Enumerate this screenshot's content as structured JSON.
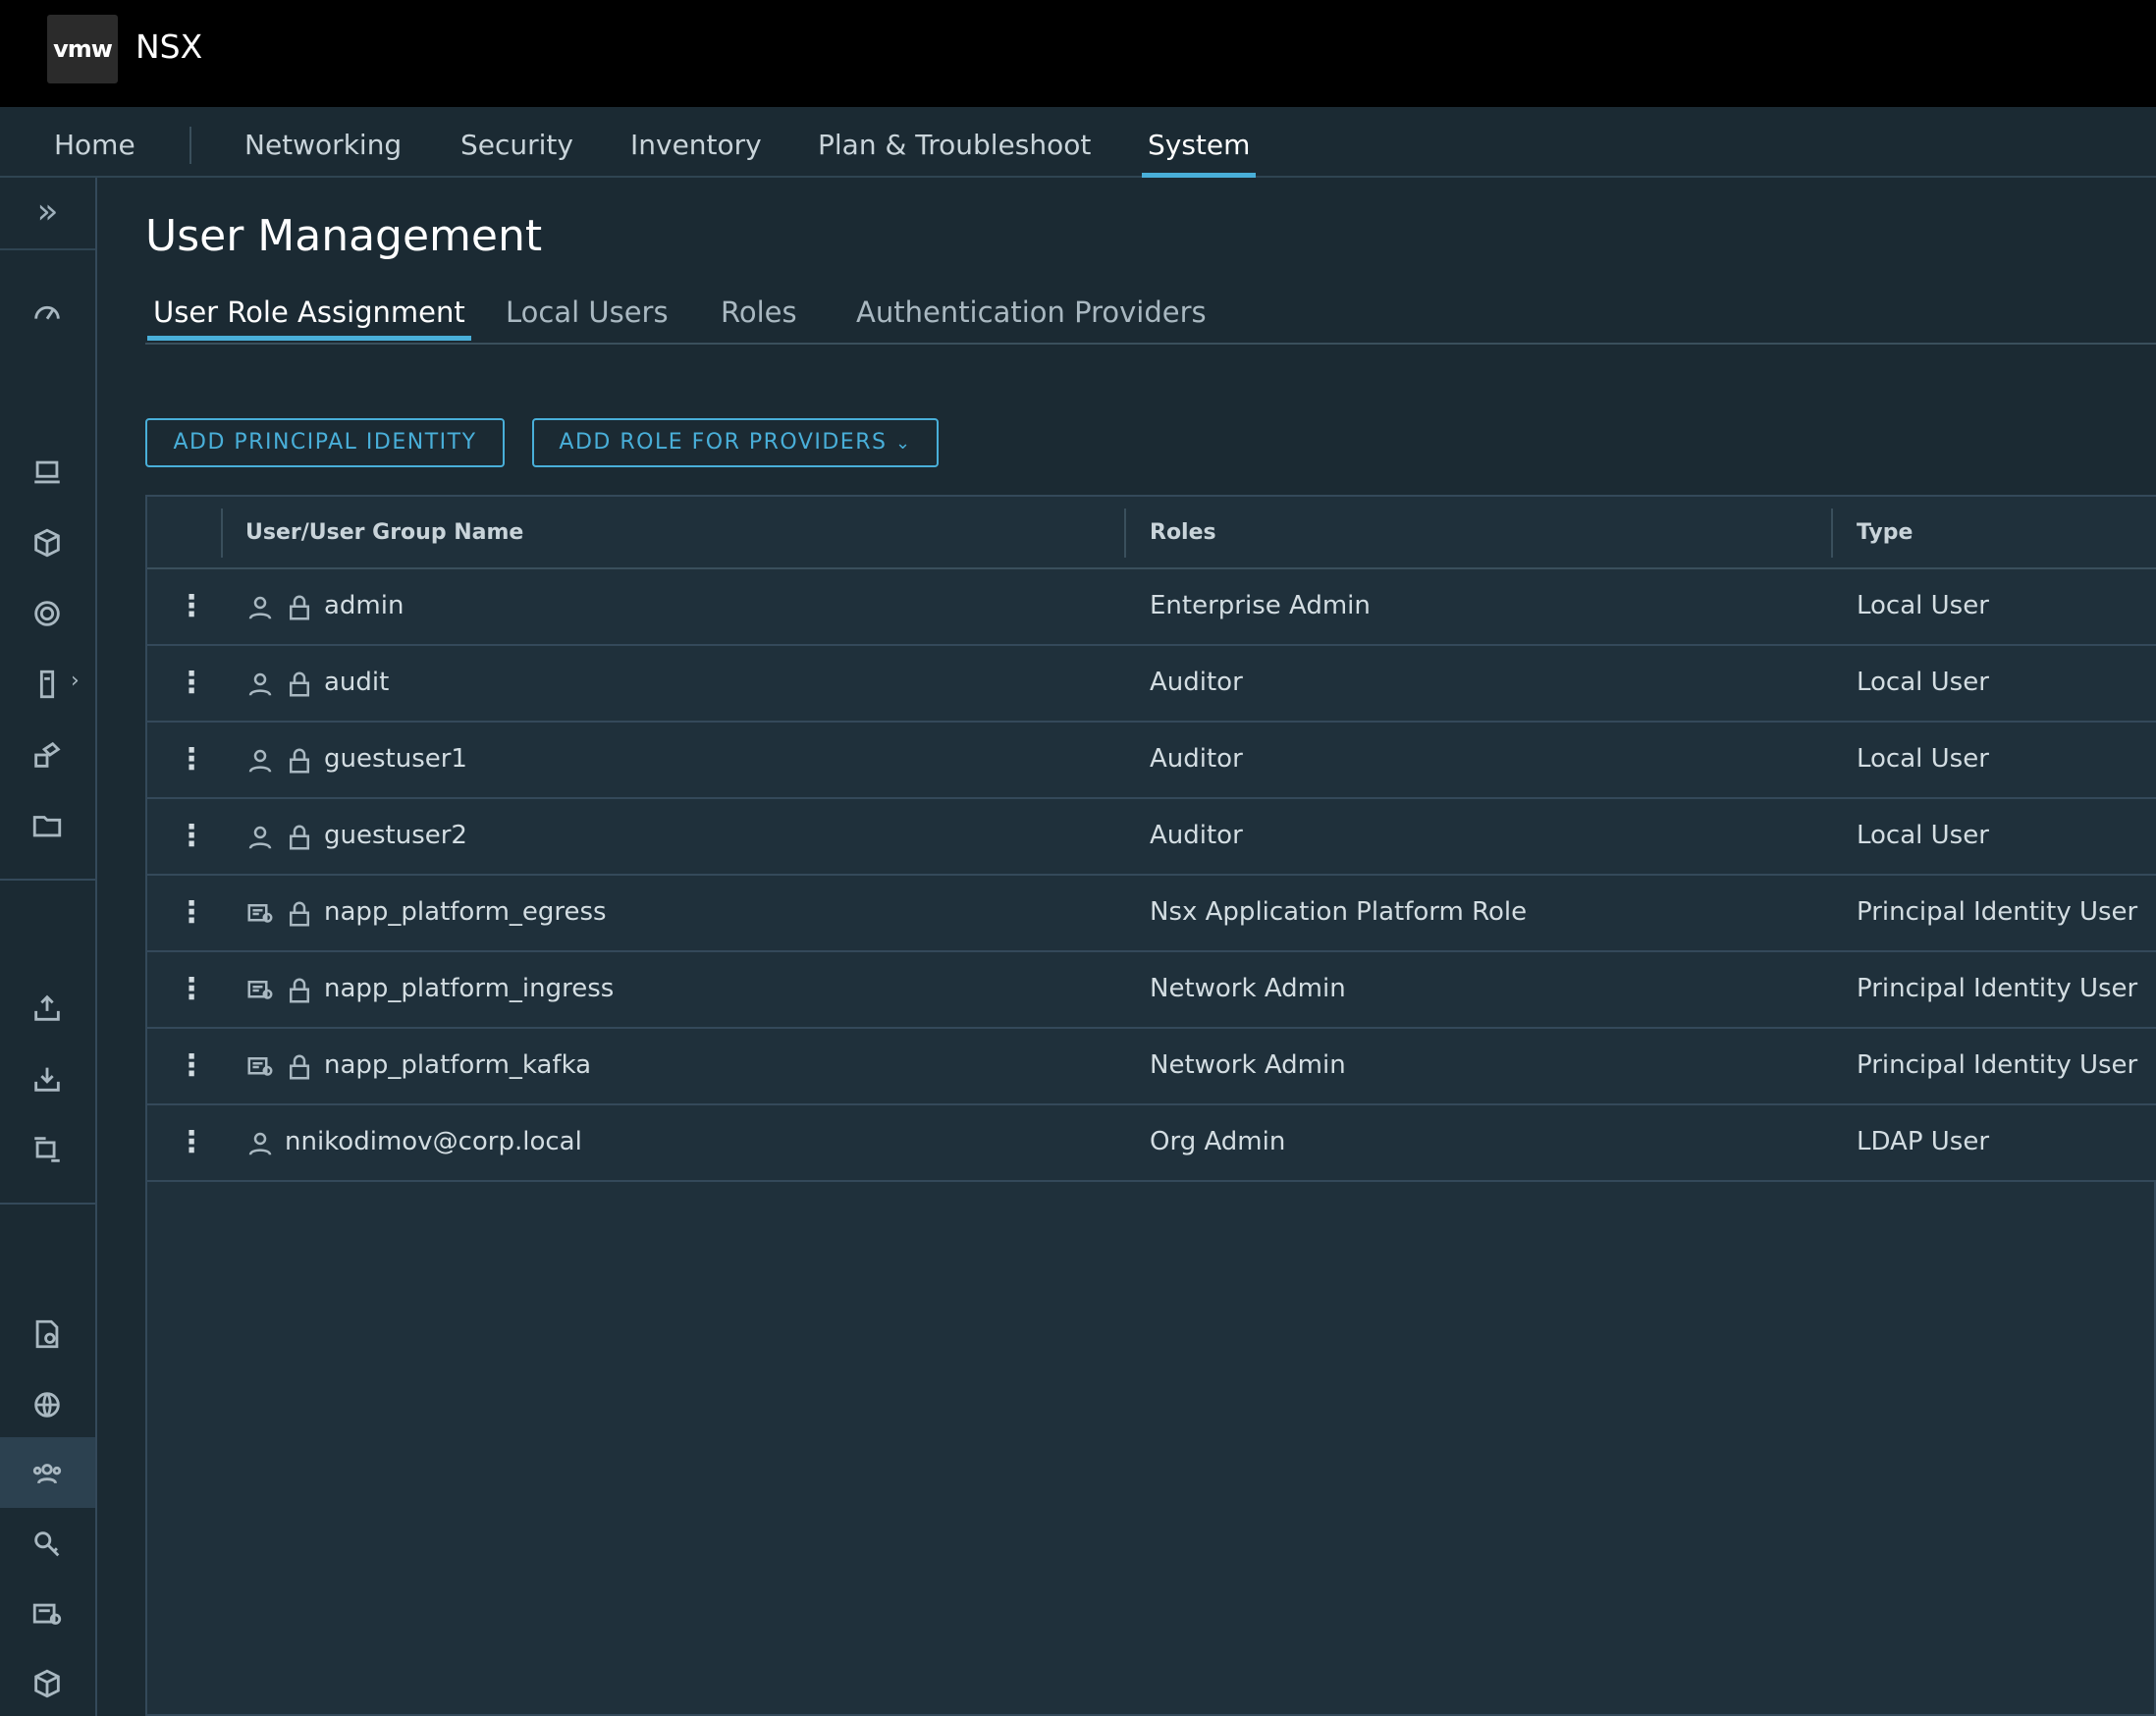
{
  "header": {
    "logo_text": "vmw",
    "product": "NSX"
  },
  "nav": {
    "items": [
      "Home",
      "Networking",
      "Security",
      "Inventory",
      "Plan & Troubleshoot",
      "System"
    ],
    "active": "System"
  },
  "sidebar": {
    "toggle_icon": "double-chevron-right-icon",
    "icons": [
      "dashboard-icon",
      "host-icon",
      "cube-icon",
      "settings-ring-icon",
      "device-icon",
      "deploy-icon",
      "folder-icon",
      "upload-icon",
      "download-icon",
      "migrate-icon",
      "certificate-settings-icon",
      "globe-icon",
      "users-icon",
      "key-icon",
      "license-icon",
      "package-icon"
    ],
    "active": "users-icon"
  },
  "page": {
    "title": "User Management"
  },
  "tabs": [
    "User Role Assignment",
    "Local Users",
    "Roles",
    "Authentication Providers"
  ],
  "actions": {
    "add_principal": "ADD PRINCIPAL IDENTITY",
    "add_role": "ADD ROLE FOR PROVIDERS"
  },
  "table": {
    "columns": [
      "User/User Group Name",
      "Roles",
      "Type"
    ],
    "rows": [
      {
        "name": "admin",
        "role": "Enterprise Admin",
        "type": "Local User",
        "icon": "user-icon",
        "locked": true
      },
      {
        "name": "audit",
        "role": "Auditor",
        "type": "Local User",
        "icon": "user-icon",
        "locked": true
      },
      {
        "name": "guestuser1",
        "role": "Auditor",
        "type": "Local User",
        "icon": "user-icon",
        "locked": true
      },
      {
        "name": "guestuser2",
        "role": "Auditor",
        "type": "Local User",
        "icon": "user-icon",
        "locked": true
      },
      {
        "name": "napp_platform_egress",
        "role": "Nsx Application Platform Role",
        "type": "Principal Identity User",
        "icon": "certificate-icon",
        "locked": true
      },
      {
        "name": "napp_platform_ingress",
        "role": "Network Admin",
        "type": "Principal Identity User",
        "icon": "certificate-icon",
        "locked": true
      },
      {
        "name": "napp_platform_kafka",
        "role": "Network Admin",
        "type": "Principal Identity User",
        "icon": "certificate-icon",
        "locked": true
      },
      {
        "name": "nnikodimov@corp.local",
        "role": "Org Admin",
        "type": "LDAP User",
        "icon": "user-icon",
        "locked": false
      }
    ]
  },
  "colors": {
    "accent": "#49afd9",
    "background": "#1b2a33",
    "header": "#000000"
  }
}
